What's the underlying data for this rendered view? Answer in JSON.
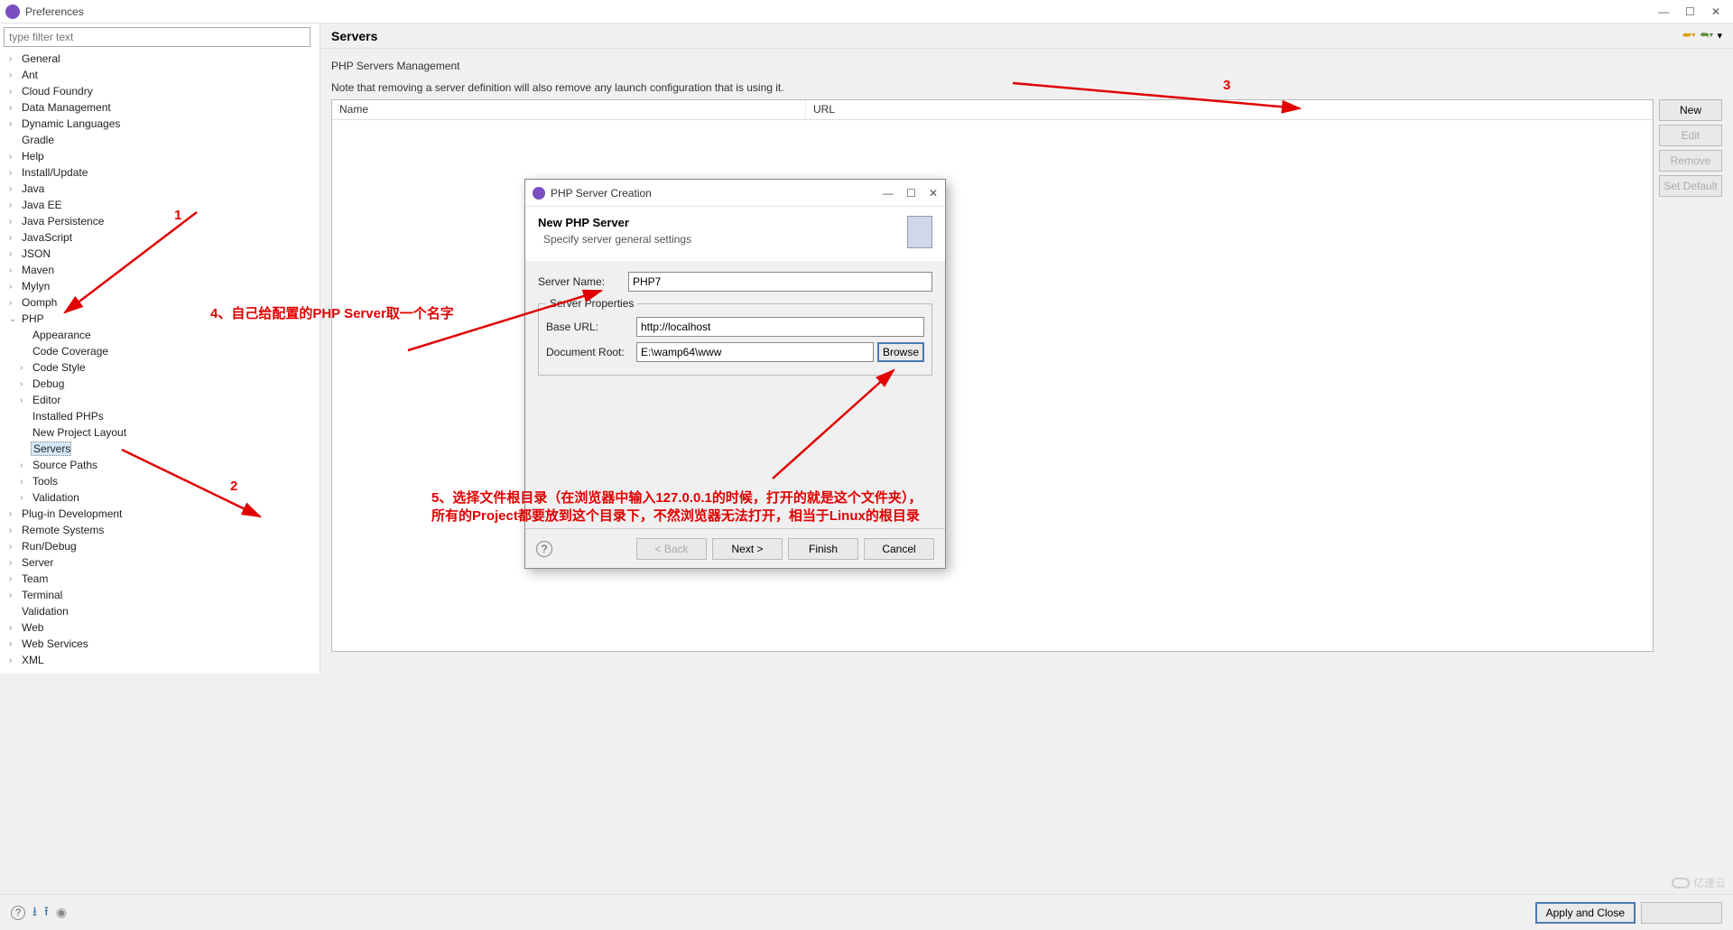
{
  "window": {
    "title": "Preferences"
  },
  "sidebar": {
    "filter_placeholder": "type filter text",
    "items": [
      {
        "label": "General",
        "exp": false
      },
      {
        "label": "Ant",
        "exp": false
      },
      {
        "label": "Cloud Foundry",
        "exp": false
      },
      {
        "label": "Data Management",
        "exp": false
      },
      {
        "label": "Dynamic Languages",
        "exp": false
      },
      {
        "label": "Gradle",
        "exp": null
      },
      {
        "label": "Help",
        "exp": false
      },
      {
        "label": "Install/Update",
        "exp": false
      },
      {
        "label": "Java",
        "exp": false
      },
      {
        "label": "Java EE",
        "exp": false
      },
      {
        "label": "Java Persistence",
        "exp": false
      },
      {
        "label": "JavaScript",
        "exp": false
      },
      {
        "label": "JSON",
        "exp": false
      },
      {
        "label": "Maven",
        "exp": false
      },
      {
        "label": "Mylyn",
        "exp": false
      },
      {
        "label": "Oomph",
        "exp": false
      },
      {
        "label": "PHP",
        "exp": true,
        "children": [
          {
            "label": "Appearance",
            "exp": null
          },
          {
            "label": "Code Coverage",
            "exp": null
          },
          {
            "label": "Code Style",
            "exp": false
          },
          {
            "label": "Debug",
            "exp": false
          },
          {
            "label": "Editor",
            "exp": false
          },
          {
            "label": "Installed PHPs",
            "exp": null
          },
          {
            "label": "New Project Layout",
            "exp": null
          },
          {
            "label": "Servers",
            "exp": null,
            "selected": true
          },
          {
            "label": "Source Paths",
            "exp": false
          },
          {
            "label": "Tools",
            "exp": false
          },
          {
            "label": "Validation",
            "exp": false
          }
        ]
      },
      {
        "label": "Plug-in Development",
        "exp": false
      },
      {
        "label": "Remote Systems",
        "exp": false
      },
      {
        "label": "Run/Debug",
        "exp": false
      },
      {
        "label": "Server",
        "exp": false
      },
      {
        "label": "Team",
        "exp": false
      },
      {
        "label": "Terminal",
        "exp": false
      },
      {
        "label": "Validation",
        "exp": null
      },
      {
        "label": "Web",
        "exp": false
      },
      {
        "label": "Web Services",
        "exp": false
      },
      {
        "label": "XML",
        "exp": false
      }
    ]
  },
  "content": {
    "title": "Servers",
    "subtitle": "PHP Servers Management",
    "note": "Note that removing a server definition will also remove any launch configuration that is using it.",
    "columns": {
      "name": "Name",
      "url": "URL"
    },
    "buttons": {
      "new": "New",
      "edit": "Edit",
      "remove": "Remove",
      "setdefault": "Set Default"
    }
  },
  "dialog": {
    "title": "PHP Server Creation",
    "heading": "New PHP Server",
    "subheading": "Specify server general settings",
    "server_name_label": "Server Name:",
    "server_name_value": "PHP7",
    "fieldset_legend": "Server Properties",
    "base_url_label": "Base URL:",
    "base_url_value": "http://localhost",
    "doc_root_label": "Document Root:",
    "doc_root_value": "E:\\wamp64\\www",
    "browse": "Browse",
    "footer": {
      "back": "< Back",
      "next": "Next >",
      "finish": "Finish",
      "cancel": "Cancel"
    }
  },
  "bottom": {
    "apply": "Apply and Close"
  },
  "annotations": {
    "a1": "1",
    "a2": "2",
    "a3": "3",
    "a4": "4、自己给配置的PHP Server取一个名字",
    "a5a": "5、选择文件根目录（在浏览器中输入127.0.0.1的时候，打开的就是这个文件夹），",
    "a5b": "所有的Project都要放到这个目录下，不然浏览器无法打开，相当于Linux的根目录"
  },
  "watermark": "亿速云"
}
